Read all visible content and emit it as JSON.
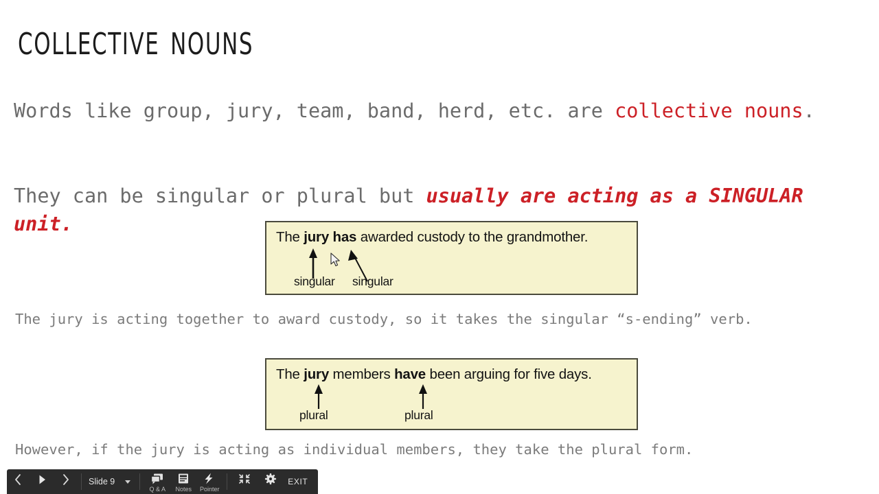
{
  "slide": {
    "title": "Collective nouns",
    "paragraph1": {
      "lead": "Words like group, jury, team, band, herd, etc. are ",
      "highlight": "collective nouns",
      "tail": "."
    },
    "paragraph2": {
      "lead": "They can be singular or plural but ",
      "highlight": "usually are acting as a SINGULAR unit.",
      "tail": ""
    },
    "caption1": "The jury is acting together to award custody, so it takes the singular “s-ending” verb.",
    "caption2": "However, if the jury is acting as individual members, they take the plural form.",
    "examples": [
      {
        "name": "singular-example",
        "sentence_parts": [
          "The ",
          "jury has",
          " awarded custody to the grandmother."
        ],
        "label_left": "singular",
        "label_right": "singular"
      },
      {
        "name": "plural-example",
        "sentence_parts": [
          "The ",
          "jury",
          " members ",
          "have",
          " been arguing for five days."
        ],
        "label_left": "plural",
        "label_right": "plural"
      }
    ],
    "colors": {
      "highlight_red": "#cc2026",
      "body_gray": "#6b6b6b",
      "example_background": "#f6f3ce",
      "example_border": "#4a4a3c",
      "toolbar_background": "#2b2b2b"
    }
  },
  "toolbar": {
    "prev_label": "Previous slide",
    "play_label": "Play",
    "next_label": "Next slide",
    "slide_indicator": "Slide 9",
    "dropdown_label": "Slide list",
    "tools": [
      {
        "icon": "qa-icon",
        "label": "Q & A"
      },
      {
        "icon": "notes-icon",
        "label": "Notes"
      },
      {
        "icon": "pointer-icon",
        "label": "Pointer"
      }
    ],
    "fullscreen_label": "Exit full screen",
    "settings_label": "Settings",
    "exit_label": "EXIT"
  }
}
